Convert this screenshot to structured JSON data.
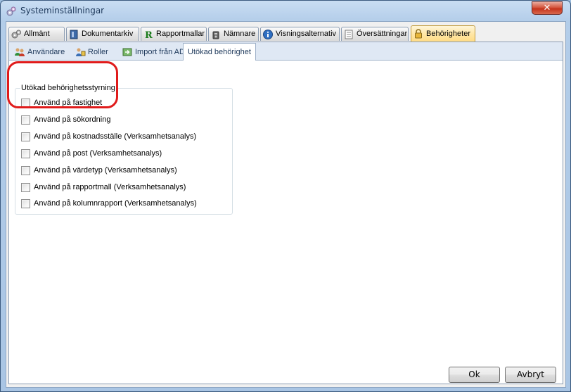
{
  "window": {
    "title": "Systeminställningar"
  },
  "title_buttons": {
    "close_glyph": "✕"
  },
  "tabs": [
    {
      "label": "Allmänt",
      "icon": "gears-icon"
    },
    {
      "label": "Dokumentarkiv",
      "icon": "binder-icon"
    },
    {
      "label": "Rapportmallar",
      "icon": "report-r-icon"
    },
    {
      "label": "Nämnare",
      "icon": "scale-icon"
    },
    {
      "label": "Visningsalternativ",
      "icon": "info-icon"
    },
    {
      "label": "Översättningar",
      "icon": "document-icon"
    },
    {
      "label": "Behörigheter",
      "icon": "lock-icon",
      "active": true
    }
  ],
  "subtabs": [
    {
      "label": "Användare",
      "icon": "users-icon"
    },
    {
      "label": "Roller",
      "icon": "roles-icon"
    },
    {
      "label": "Import från AD",
      "icon": "import-icon"
    },
    {
      "label": "Utökad behörighet",
      "active": true
    }
  ],
  "group": {
    "legend": "Utökad behörighetsstyrning",
    "options": [
      {
        "label": "Använd på fastighet",
        "checked": false
      },
      {
        "label": "Använd på sökordning",
        "checked": false
      },
      {
        "label": "Använd på kostnadsställe (Verksamhetsanalys)",
        "checked": false
      },
      {
        "label": "Använd på post (Verksamhetsanalys)",
        "checked": false
      },
      {
        "label": "Använd på värdetyp (Verksamhetsanalys)",
        "checked": false
      },
      {
        "label": "Använd på rapportmall (Verksamhetsanalys)",
        "checked": false
      },
      {
        "label": "Använd på kolumnrapport (Verksamhetsanalys)",
        "checked": false
      }
    ]
  },
  "buttons": {
    "ok": "Ok",
    "cancel": "Avbryt"
  },
  "colors": {
    "highlight": "#e01b1b",
    "active_tab": "#ffdc85",
    "titlebar": "#b3cde9"
  }
}
